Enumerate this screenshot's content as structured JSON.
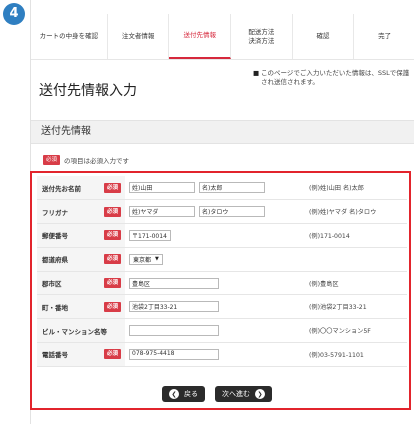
{
  "step_badge": "4",
  "steps": [
    {
      "label": "カートの中身を確認",
      "active": false
    },
    {
      "label": "注文者情報",
      "active": false
    },
    {
      "label": "送付先情報",
      "active": true
    },
    {
      "label": "配送方法\n決済方法",
      "active": false
    },
    {
      "label": "確認",
      "active": false
    },
    {
      "label": "完了",
      "active": false
    }
  ],
  "page_title": "送付先情報入力",
  "privacy_note": "このページでご入力いただいた情報は、SSLで保護され送信されます。",
  "section_title": "送付先情報",
  "required_badge": "必須",
  "required_legend": "の項目は必須入力です",
  "rows": [
    {
      "label": "送付先お名前",
      "required": true,
      "type": "name",
      "value1": "姓)山田",
      "value2": "名)太郎",
      "example": "(例)姓)山田 名)太郎"
    },
    {
      "label": "フリガナ",
      "required": true,
      "type": "name",
      "value1": "姓)ヤマダ",
      "value2": "名)タロウ",
      "example": "(例)姓)ヤマダ 名)タロウ"
    },
    {
      "label": "郵便番号",
      "required": true,
      "type": "zip",
      "value1": "〒171-0014",
      "example": "(例)171-0014"
    },
    {
      "label": "都道府県",
      "required": true,
      "type": "select",
      "value1": "東京都",
      "example": ""
    },
    {
      "label": "郡市区",
      "required": true,
      "type": "text",
      "value1": "豊島区",
      "example": "(例)豊島区"
    },
    {
      "label": "町・番地",
      "required": true,
      "type": "text",
      "value1": "池袋2丁目33-21",
      "example": "(例)池袋2丁目33-21"
    },
    {
      "label": "ビル・マンション名等",
      "required": false,
      "type": "text",
      "value1": "",
      "example": "(例)〇〇マンション5F"
    },
    {
      "label": "電話番号",
      "required": true,
      "type": "text",
      "value1": "078-975-4418",
      "example": "(例)03-5791-1101"
    }
  ],
  "buttons": {
    "back_label": "戻る",
    "next_label": "次へ進む"
  }
}
